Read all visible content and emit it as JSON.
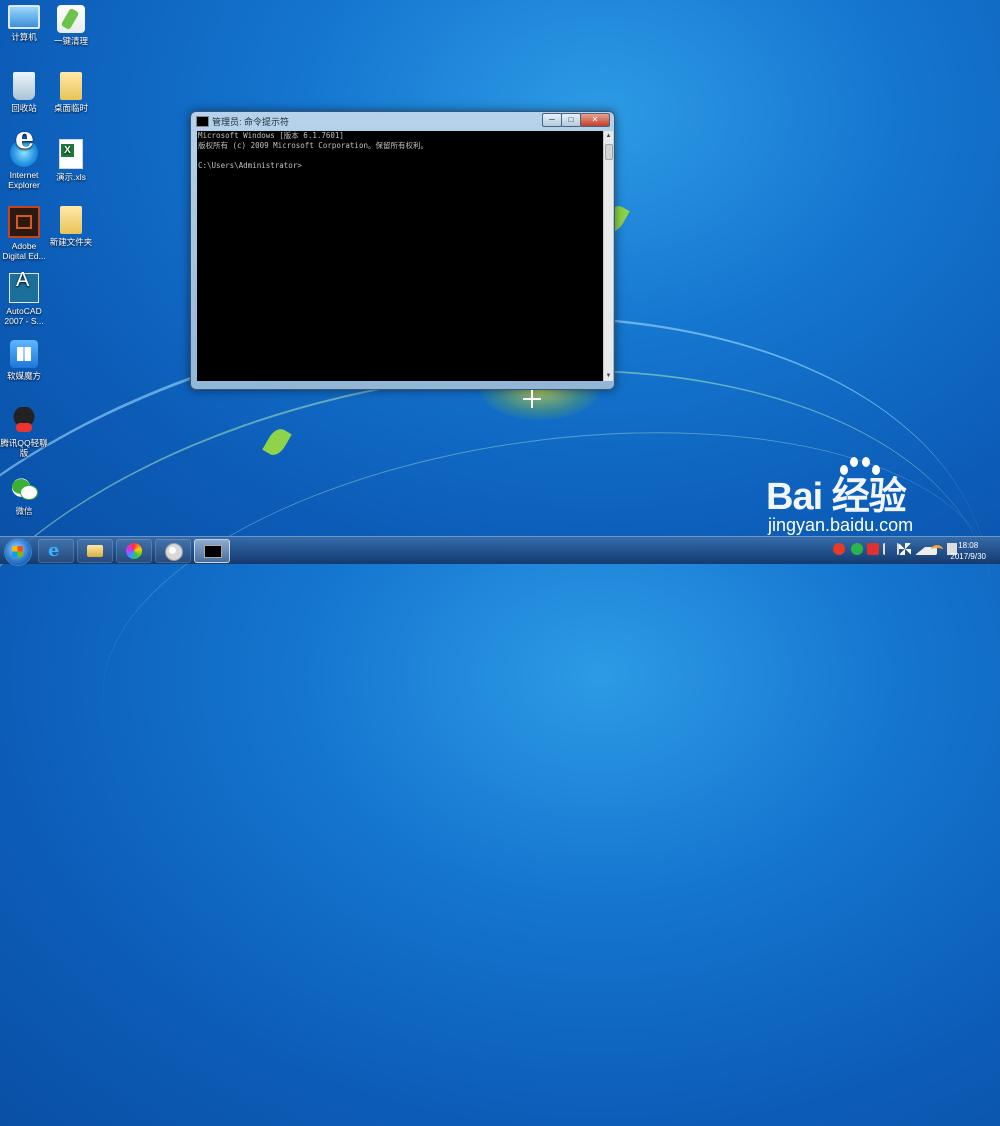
{
  "desktop": {
    "icons": [
      {
        "label": "计算机",
        "icon": "computer-icon"
      },
      {
        "label": "一键清理",
        "icon": "broom-icon"
      },
      {
        "label": "回收站",
        "icon": "recycle-bin-icon"
      },
      {
        "label": "桌面临时",
        "icon": "folder-icon"
      },
      {
        "label": "Internet Explorer",
        "icon": "ie-icon"
      },
      {
        "label": "演示.xls",
        "icon": "excel-icon"
      },
      {
        "label": "Adobe Digital Ed...",
        "icon": "adobe-digital-editions-icon"
      },
      {
        "label": "新建文件夹",
        "icon": "folder-icon"
      },
      {
        "label": "AutoCAD 2007 - S...",
        "icon": "autocad-icon"
      },
      {
        "label": "软媒魔方",
        "icon": "softmedia-cube-icon"
      },
      {
        "label": "腾讯QQ轻聊版",
        "icon": "qq-icon"
      },
      {
        "label": "微信",
        "icon": "wechat-icon"
      }
    ]
  },
  "cmd_window": {
    "title": "管理员: 命令提示符",
    "lines": [
      "Microsoft Windows [版本 6.1.7601]",
      "版权所有 (c) 2009 Microsoft Corporation。保留所有权利。",
      "",
      "C:\\Users\\Administrator>"
    ],
    "min_label": "─",
    "max_label": "□",
    "close_label": "✕"
  },
  "watermark": {
    "brand": "Bai  经验",
    "url": "jingyan.baidu.com"
  },
  "taskbar": {
    "items": [
      {
        "name": "Internet Explorer",
        "icon": "ie-icon"
      },
      {
        "name": "Windows Explorer",
        "icon": "folder-icon"
      },
      {
        "name": "Color app",
        "icon": "color-wheel-icon"
      },
      {
        "name": "Paint",
        "icon": "paint-palette-icon"
      },
      {
        "name": "命令提示符",
        "icon": "cmd-icon",
        "active": true
      }
    ],
    "clock": {
      "time": "18:08",
      "date": "2017/9/30"
    }
  },
  "colors": {
    "desktop_bg": "#1576cf",
    "terminal_bg": "#000000",
    "terminal_fg": "#c0c0c0"
  }
}
